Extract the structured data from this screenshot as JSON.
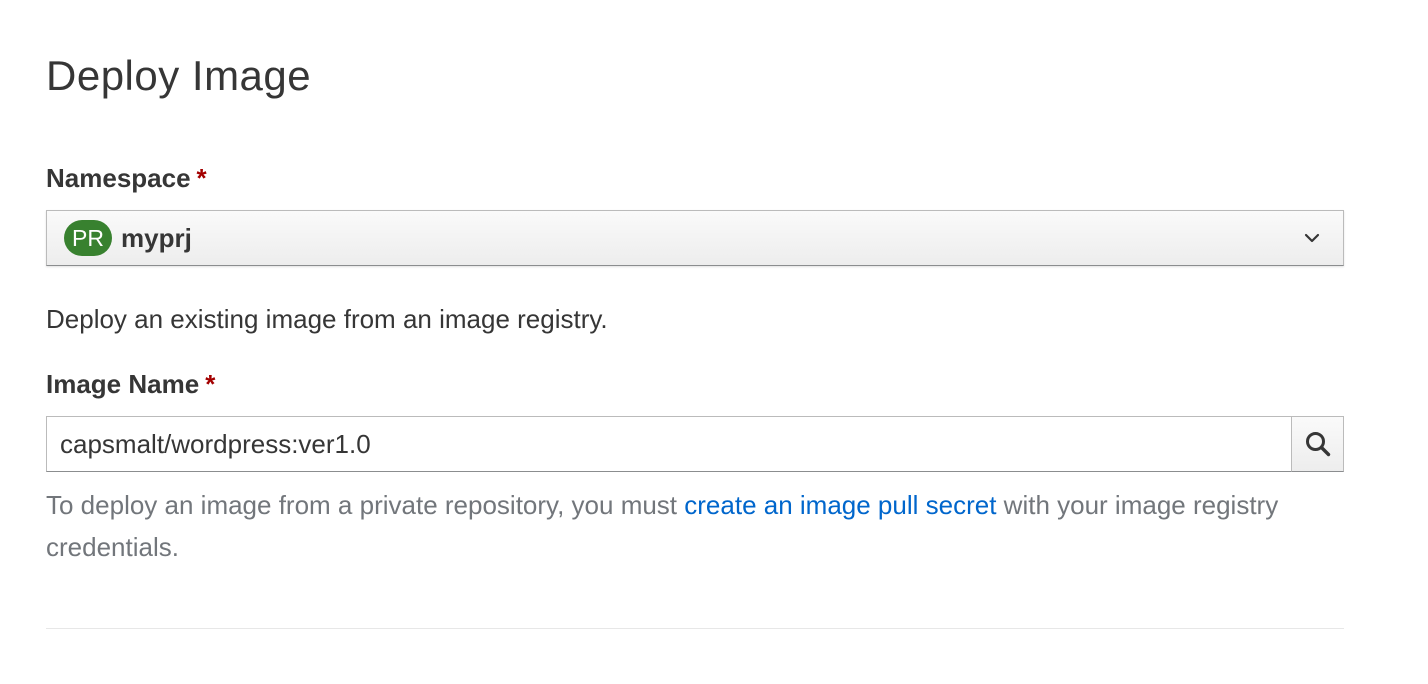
{
  "page": {
    "title": "Deploy Image"
  },
  "namespace": {
    "label": "Namespace",
    "required_marker": "*",
    "badge": "PR",
    "value": "myprj",
    "icon": "chevron-down-icon"
  },
  "description": "Deploy an existing image from an image registry.",
  "image_name": {
    "label": "Image Name",
    "required_marker": "*",
    "value": "capsmalt/wordpress:ver1.0",
    "search_icon": "search-icon"
  },
  "note": {
    "prefix": "To deploy an image from a private repository, you must ",
    "link_text": "create an image pull secret",
    "suffix": " with your image registry credentials."
  },
  "colors": {
    "required": "#a30000",
    "badge_bg": "#38812f",
    "link": "#0066cc",
    "muted_text": "#72767b"
  }
}
